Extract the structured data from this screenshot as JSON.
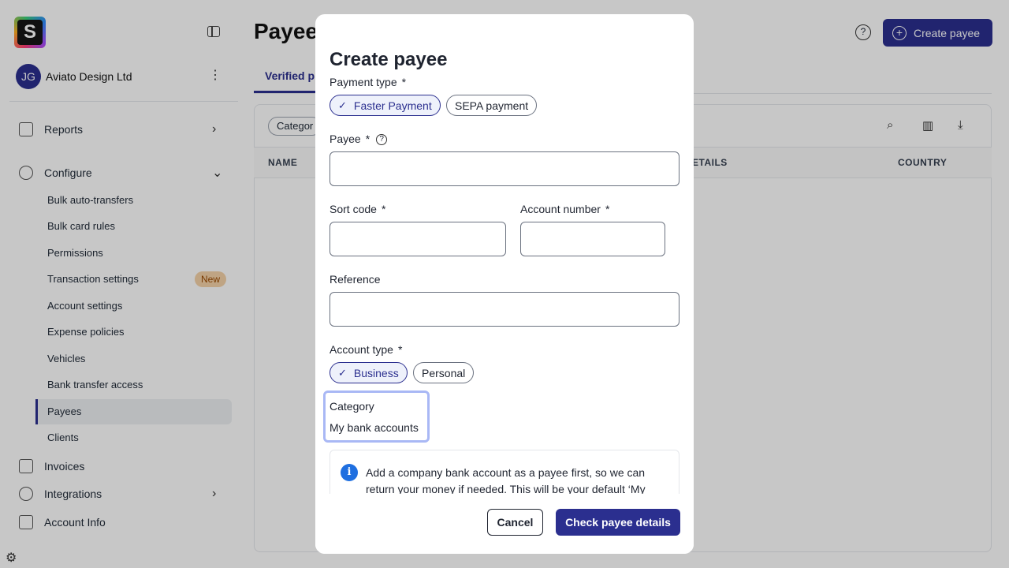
{
  "sidebar": {
    "org_initials": "JG",
    "org_name": "Aviato Design Ltd",
    "reports": "Reports",
    "configure": "Configure",
    "items": [
      "Bulk auto-transfers",
      "Bulk card rules",
      "Permissions",
      "Transaction settings",
      "Account settings",
      "Expense policies",
      "Vehicles",
      "Bank transfer access",
      "Payees",
      "Clients"
    ],
    "new_badge": "New",
    "invoices": "Invoices",
    "integrations": "Integrations",
    "account_info": "Account Info"
  },
  "main": {
    "title": "Payees",
    "create_button": "Create payee",
    "tab_verified": "Verified p",
    "filter_chip": "Categor",
    "col_name": "NAME",
    "col_details": "ETAILS",
    "col_country": "COUNTRY"
  },
  "modal": {
    "title": "Create payee",
    "payment_type_label": "Payment type",
    "required_mark": "*",
    "payment_types": {
      "selected": "Faster Payment",
      "other": "SEPA payment"
    },
    "payee_label": "Payee",
    "payee_value": "",
    "sort_code_label": "Sort code",
    "sort_code_value": "",
    "account_number_label": "Account number",
    "account_number_value": "",
    "reference_label": "Reference",
    "reference_value": "",
    "account_type_label": "Account type",
    "account_types": {
      "selected": "Business",
      "other": "Personal"
    },
    "category_label": "Category",
    "category_value": "My bank accounts",
    "info_text": "Add a company bank account as a payee first, so we can return your money if needed. This will be your default ‘My",
    "cancel": "Cancel",
    "check": "Check payee details"
  },
  "colors": {
    "accent": "#2b2f8f",
    "info": "#1f6fe0",
    "focus": "#a9b8f5"
  }
}
